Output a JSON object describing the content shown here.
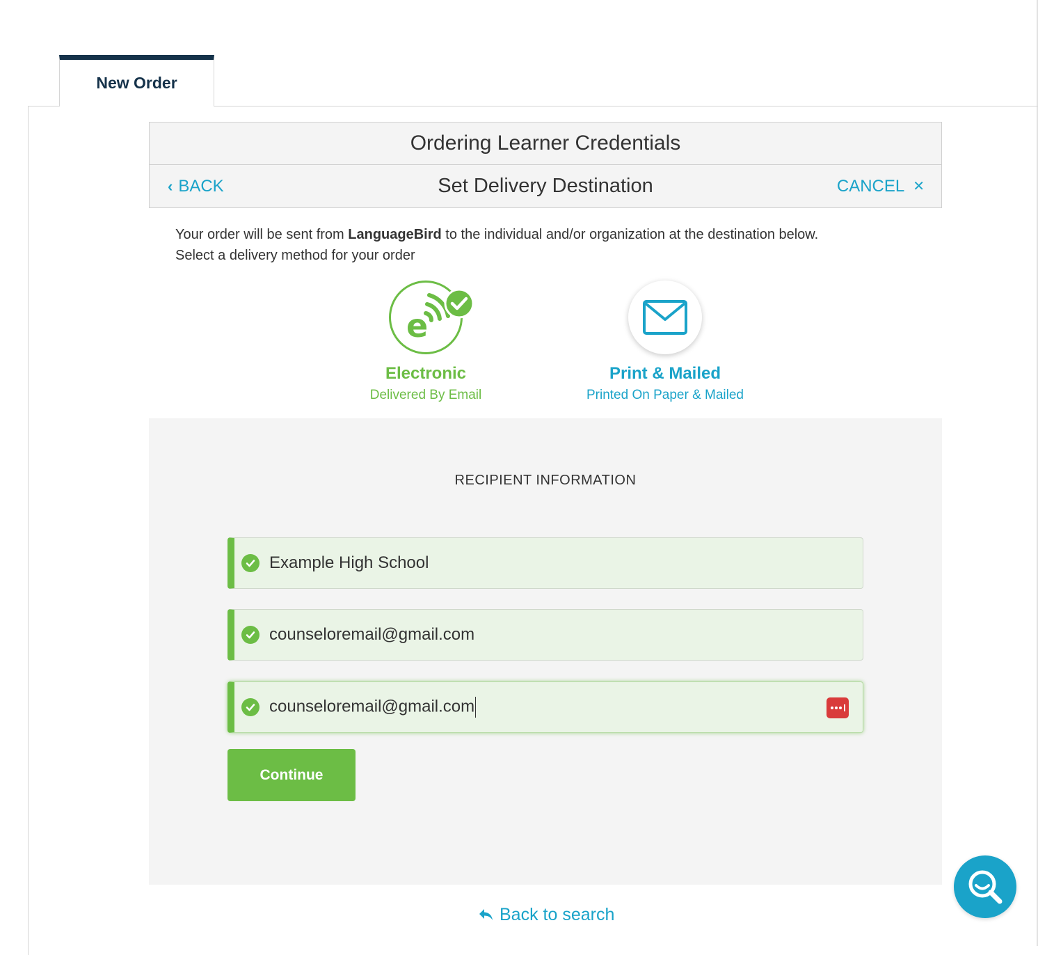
{
  "tabs": [
    {
      "label": "New Order"
    }
  ],
  "header": {
    "title": "Ordering Learner Credentials",
    "step_title": "Set Delivery Destination",
    "back_label": "BACK",
    "cancel_label": "CANCEL"
  },
  "intro": {
    "prefix": "Your order will be sent from ",
    "sender": "LanguageBird",
    "suffix": " to the individual and/or organization at the destination below.",
    "line2": "Select a delivery method for your order"
  },
  "delivery_methods": [
    {
      "label": "Electronic",
      "sublabel": "Delivered By Email",
      "selected": true,
      "icon": "electronic-delivery-icon",
      "color": "#6cbd45"
    },
    {
      "label": "Print & Mailed",
      "sublabel": "Printed On Paper & Mailed",
      "selected": false,
      "icon": "envelope-icon",
      "color": "#1aa3c9"
    }
  ],
  "recipient": {
    "heading": "RECIPIENT INFORMATION",
    "fields": [
      {
        "value": "Example High School",
        "valid": true
      },
      {
        "value": "counseloremail@gmail.com",
        "valid": true
      },
      {
        "value": "counseloremail@gmail.com",
        "valid": true,
        "focused": true
      }
    ],
    "continue_label": "Continue"
  },
  "footer": {
    "back_to_search": "Back to search"
  },
  "colors": {
    "accent_blue": "#1aa3c9",
    "success_green": "#6cbd45",
    "tab_navy": "#15324a",
    "password_icon_red": "#d93b3b"
  }
}
